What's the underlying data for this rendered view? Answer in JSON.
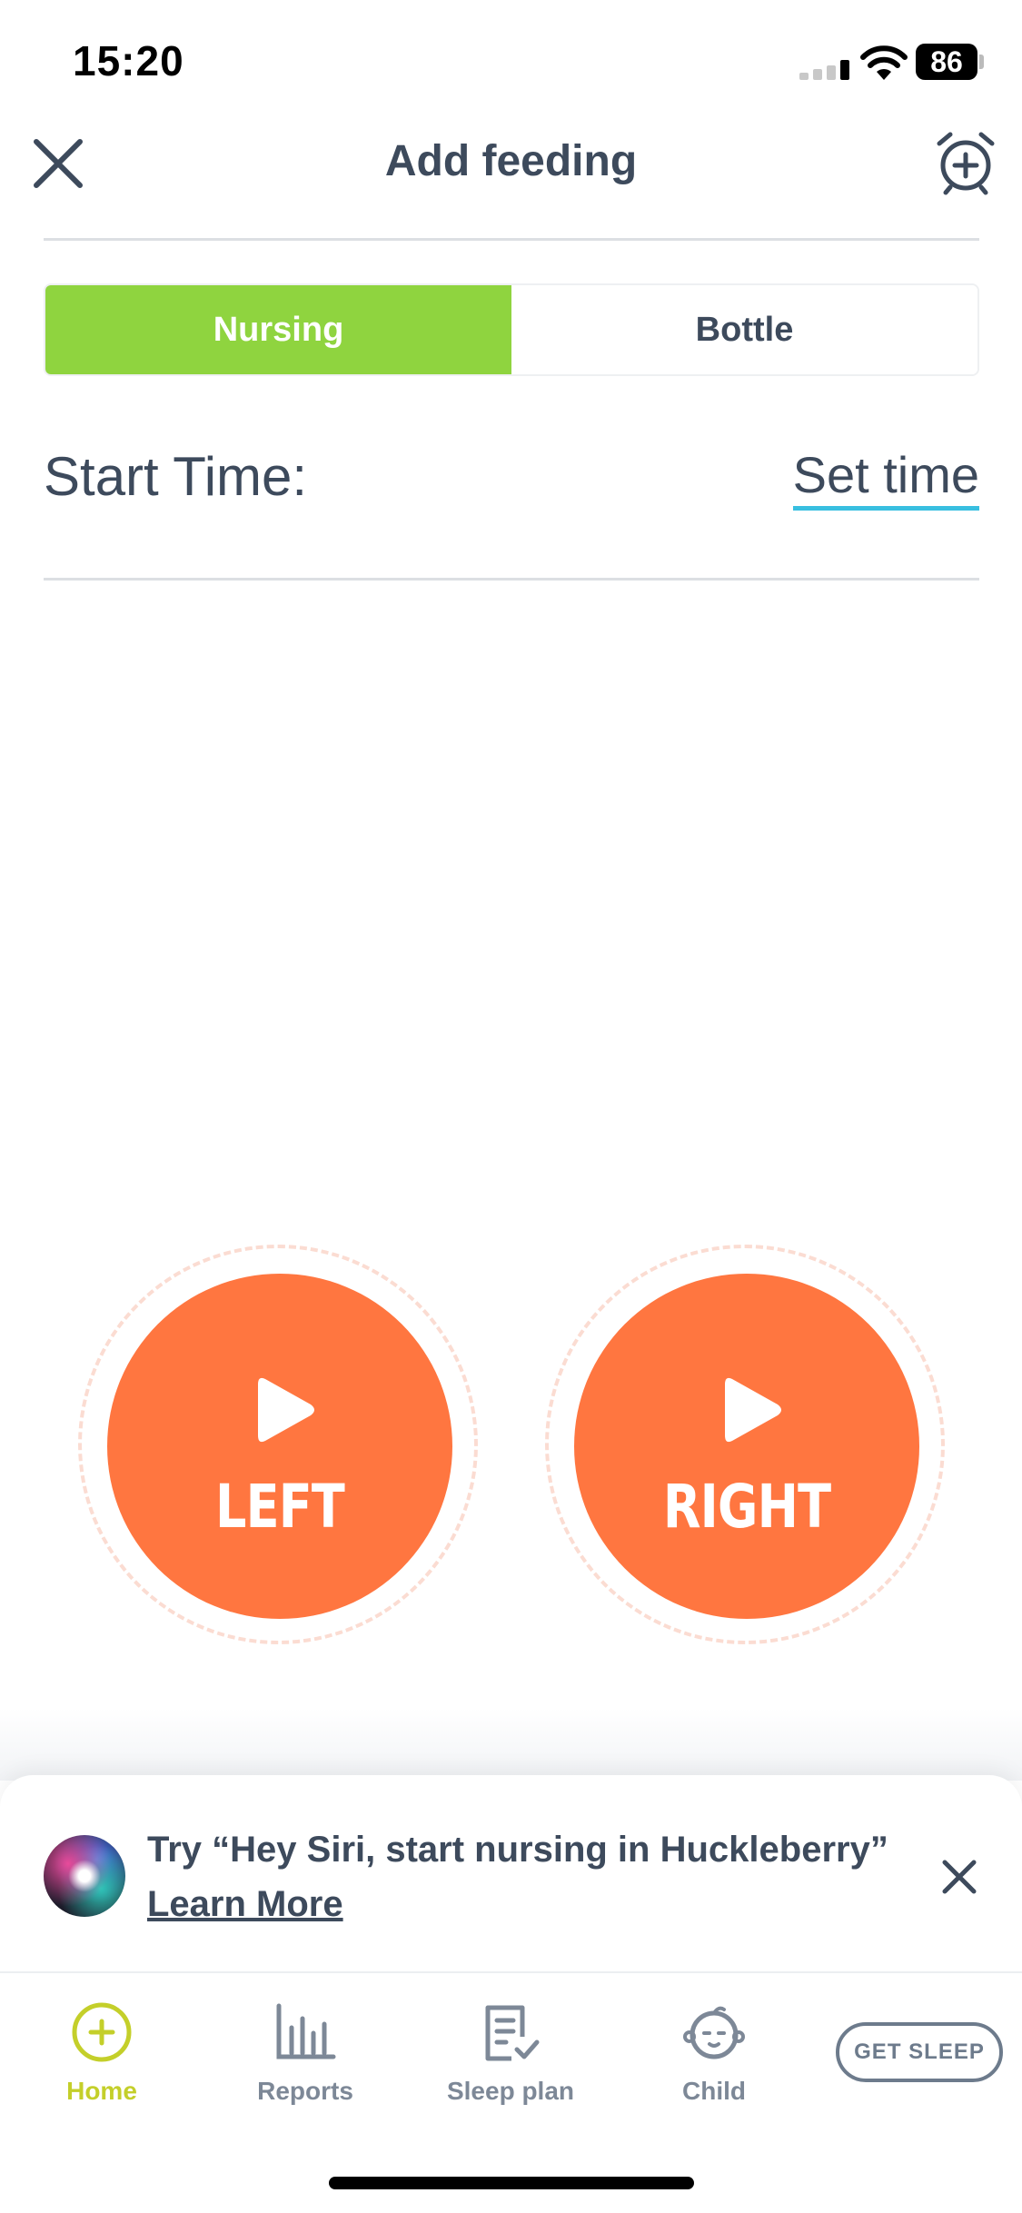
{
  "status_bar": {
    "time": "15:20",
    "battery": "86"
  },
  "header": {
    "title": "Add feeding"
  },
  "segment": {
    "nursing": "Nursing",
    "bottle": "Bottle"
  },
  "start_time": {
    "label": "Start Time:",
    "set_time": "Set time"
  },
  "sides": {
    "left": "LEFT",
    "right": "RIGHT"
  },
  "siri_banner": {
    "text": "Try “Hey Siri, start nursing in Huckleberry” ",
    "link": "Learn More"
  },
  "tabs": [
    {
      "label": "Home"
    },
    {
      "label": "Reports"
    },
    {
      "label": "Sleep plan"
    },
    {
      "label": "Child"
    }
  ],
  "get_sleep": "GET SLEEP",
  "colors": {
    "accent_green": "#8fd43f",
    "nursing_orange": "#ff7640",
    "underline_blue": "#38bfe0",
    "home_tab": "#c4cf2a",
    "text_dark": "#3d4a5c"
  }
}
